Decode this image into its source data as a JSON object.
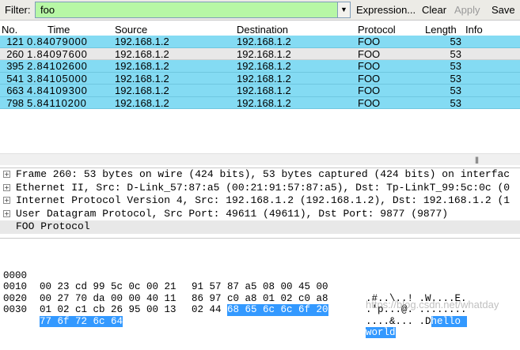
{
  "filterbar": {
    "label": "Filter:",
    "value": "foo",
    "input_color": "#b7f7a5",
    "buttons": [
      {
        "label": "Expression...",
        "enabled": true
      },
      {
        "label": "Clear",
        "enabled": true
      },
      {
        "label": "Apply",
        "enabled": false
      },
      {
        "label": "Save",
        "enabled": true
      }
    ]
  },
  "packet_list": {
    "headers": [
      "No.",
      "Time",
      "Source",
      "Destination",
      "Protocol",
      "Length",
      "Info"
    ],
    "rows": [
      {
        "no": "121",
        "time": "0.84079000",
        "source": "192.168.1.2",
        "destination": "192.168.1.2",
        "protocol": "FOO",
        "length": "53",
        "info": "",
        "selected": false
      },
      {
        "no": "260",
        "time": "1.84097600",
        "source": "192.168.1.2",
        "destination": "192.168.1.2",
        "protocol": "FOO",
        "length": "53",
        "info": "",
        "selected": true
      },
      {
        "no": "395",
        "time": "2.84102600",
        "source": "192.168.1.2",
        "destination": "192.168.1.2",
        "protocol": "FOO",
        "length": "53",
        "info": "",
        "selected": false
      },
      {
        "no": "541",
        "time": "3.84105000",
        "source": "192.168.1.2",
        "destination": "192.168.1.2",
        "protocol": "FOO",
        "length": "53",
        "info": "",
        "selected": false
      },
      {
        "no": "663",
        "time": "4.84109300",
        "source": "192.168.1.2",
        "destination": "192.168.1.2",
        "protocol": "FOO",
        "length": "53",
        "info": "",
        "selected": false
      },
      {
        "no": "798",
        "time": "5.84110200",
        "source": "192.168.1.2",
        "destination": "192.168.1.2",
        "protocol": "FOO",
        "length": "53",
        "info": "",
        "selected": false
      }
    ],
    "row_color": "#84dbf3"
  },
  "details": [
    {
      "text": "Frame 260: 53 bytes on wire (424 bits), 53 bytes captured (424 bits) on interfac",
      "expandable": true
    },
    {
      "text": "Ethernet II, Src: D-Link_57:87:a5 (00:21:91:57:87:a5), Dst: Tp-LinkT_99:5c:0c (0",
      "expandable": true
    },
    {
      "text": "Internet Protocol Version 4, Src: 192.168.1.2 (192.168.1.2), Dst: 192.168.1.2 (1",
      "expandable": true
    },
    {
      "text": "User Datagram Protocol, Src Port: 49611 (49611), Dst Port: 9877 (9877)",
      "expandable": true
    },
    {
      "text": "FOO Protocol",
      "expandable": false
    }
  ],
  "hex_dump": [
    {
      "offset": "0000",
      "bytes": [
        "00",
        "23",
        "cd",
        "99",
        "5c",
        "0c",
        "00",
        "21",
        "91",
        "57",
        "87",
        "a5",
        "08",
        "00",
        "45",
        "00"
      ],
      "highlight_from": -1,
      "ascii": ".#..\\..! .W....E."
    },
    {
      "offset": "0010",
      "bytes": [
        "00",
        "27",
        "70",
        "da",
        "00",
        "00",
        "40",
        "11",
        "86",
        "97",
        "c0",
        "a8",
        "01",
        "02",
        "c0",
        "a8"
      ],
      "highlight_from": -1,
      "ascii": ".'p...@. ........"
    },
    {
      "offset": "0020",
      "bytes": [
        "01",
        "02",
        "c1",
        "cb",
        "26",
        "95",
        "00",
        "13",
        "02",
        "44",
        "68",
        "65",
        "6c",
        "6c",
        "6f",
        "20"
      ],
      "highlight_from": 10,
      "ascii_plain": "....&... .D",
      "ascii_hl": "hello "
    },
    {
      "offset": "0030",
      "bytes": [
        "77",
        "6f",
        "72",
        "6c",
        "64"
      ],
      "highlight_from": 0,
      "ascii_plain": "",
      "ascii_hl": "world"
    }
  ],
  "highlight_color": "#3399ff",
  "watermark": "https://blog.csdn.net/whatday"
}
